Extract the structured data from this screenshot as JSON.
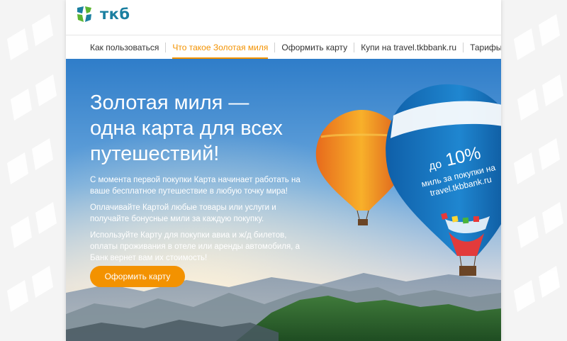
{
  "brand": {
    "name": "ткб",
    "colors": {
      "teal": "#1a7fa0",
      "green": "#5bb531",
      "orange": "#f39200"
    }
  },
  "nav": {
    "items": [
      {
        "label": "Как пользоваться"
      },
      {
        "label": "Что такое Золотая миля",
        "active": true
      },
      {
        "label": "Оформить карту"
      },
      {
        "label": "Купи на travel.tkbbank.ru"
      },
      {
        "label": "Тарифы"
      }
    ]
  },
  "hero": {
    "title_line1": "Золотая миля —",
    "title_line2": "одна карта для всех",
    "title_line3": "путешествий!",
    "p1": "С момента первой покупки Карта начинает работать на ваше бесплатное путешествие в любую точку мира!",
    "p2": "Оплачивайте Картой любые товары или услуги и получайте бонусные мили за каждую покупку.",
    "p3": "Используйте Карту для покупки авиа и ж/д билетов, оплаты проживания в отеле или аренды автомобиля, а Банк вернет вам их стоимость!",
    "cta_label": "Оформить карту"
  },
  "promo": {
    "prefix": "до",
    "percent": "10%",
    "line2": "миль за покупки на",
    "line3": "travel.tkbbank.ru"
  }
}
